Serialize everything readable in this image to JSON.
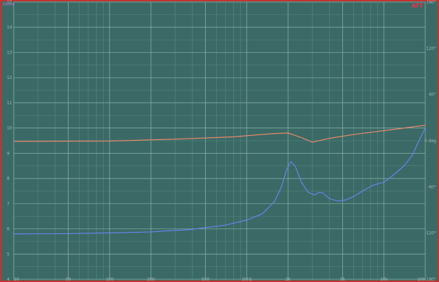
{
  "chart_data": {
    "type": "line",
    "brand": "ATT",
    "left_axis": {
      "unit": "Ohms",
      "ticks": [
        "4",
        "5",
        "6",
        "7",
        "8",
        "9",
        "10",
        "11",
        "12",
        "13",
        "14",
        "15"
      ],
      "range": [
        4,
        15
      ]
    },
    "right_axis": {
      "ticks": [
        "180°",
        "120°",
        "60°",
        "0 deg",
        "-60°",
        "-120°",
        "-180°"
      ],
      "range": [
        -180,
        180
      ]
    },
    "x_axis": {
      "scale": "log",
      "range": [
        20,
        20000
      ],
      "ticks": [
        {
          "value": 20,
          "label": "20"
        },
        {
          "value": 50,
          "label": "50"
        },
        {
          "value": 100,
          "label": "100"
        },
        {
          "value": 200,
          "label": "200"
        },
        {
          "value": 500,
          "label": "500"
        },
        {
          "value": 1000,
          "label": "1kHz"
        },
        {
          "value": 2000,
          "label": "2k"
        },
        {
          "value": 5000,
          "label": "5k"
        },
        {
          "value": 10000,
          "label": "10k"
        },
        {
          "value": 20000,
          "label": "20k"
        }
      ]
    },
    "grid": true,
    "colors": {
      "impedance": "#6f84ff",
      "phase": "#ff8a6a",
      "grid_major": "#8fb2ad",
      "grid_minor": "#5a8a85",
      "background": "#3b6a66",
      "frame": "#c8322e"
    },
    "series": [
      {
        "axis": "left",
        "color": "#6f84ff",
        "points": [
          [
            20,
            5.8
          ],
          [
            50,
            5.81
          ],
          [
            100,
            5.84
          ],
          [
            200,
            5.88
          ],
          [
            400,
            5.98
          ],
          [
            700,
            6.15
          ],
          [
            1000,
            6.35
          ],
          [
            1300,
            6.6
          ],
          [
            1600,
            7.1
          ],
          [
            1800,
            7.7
          ],
          [
            1950,
            8.35
          ],
          [
            2100,
            8.67
          ],
          [
            2250,
            8.5
          ],
          [
            2500,
            7.85
          ],
          [
            2800,
            7.45
          ],
          [
            3100,
            7.35
          ],
          [
            3400,
            7.45
          ],
          [
            3600,
            7.42
          ],
          [
            4000,
            7.2
          ],
          [
            4600,
            7.1
          ],
          [
            5300,
            7.15
          ],
          [
            6000,
            7.28
          ],
          [
            7200,
            7.55
          ],
          [
            8500,
            7.75
          ],
          [
            10000,
            7.85
          ],
          [
            11500,
            8.1
          ],
          [
            14000,
            8.5
          ],
          [
            16000,
            8.9
          ],
          [
            18000,
            9.5
          ],
          [
            20000,
            10.0
          ]
        ]
      },
      {
        "axis": "right",
        "color": "#ff8a6a",
        "points": [
          [
            20,
            -1
          ],
          [
            100,
            -0.5
          ],
          [
            300,
            2
          ],
          [
            800,
            5
          ],
          [
            1500,
            9
          ],
          [
            2000,
            10
          ],
          [
            2500,
            4
          ],
          [
            3000,
            -2
          ],
          [
            4000,
            3
          ],
          [
            6000,
            8
          ],
          [
            10000,
            13
          ],
          [
            20000,
            20
          ]
        ]
      }
    ]
  }
}
